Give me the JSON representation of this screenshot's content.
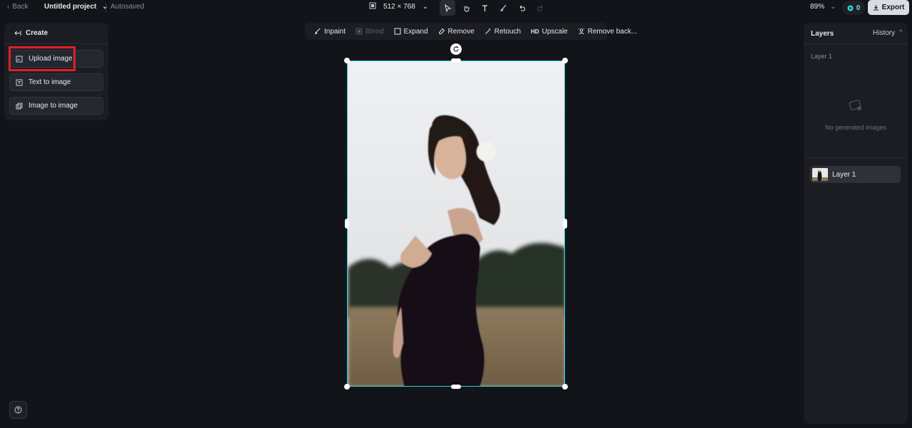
{
  "header": {
    "back": "Back",
    "project": "Untitled project",
    "autosaved": "Autosaved",
    "canvas_size": "512 × 768",
    "zoom": "89%",
    "credits": "0",
    "export": "Export"
  },
  "left_panel": {
    "title": "Create",
    "items": [
      {
        "label": "Upload image"
      },
      {
        "label": "Text to image"
      },
      {
        "label": "Image to image"
      }
    ]
  },
  "image_toolbar": {
    "items": [
      {
        "label": "Inpaint"
      },
      {
        "label": "Blend"
      },
      {
        "label": "Expand"
      },
      {
        "label": "Remove"
      },
      {
        "label": "Retouch"
      },
      {
        "label": "Upscale",
        "prefix": "HD"
      },
      {
        "label": "Remove back..."
      }
    ]
  },
  "right_panel": {
    "title": "Layers",
    "history": "History",
    "section_label": "Layer 1",
    "empty_text": "No generated images",
    "layers": [
      {
        "label": "Layer 1"
      }
    ]
  },
  "colors": {
    "selection": "#2fd3d3",
    "highlight": "#e01f26",
    "credits": "#7fd4ff"
  }
}
